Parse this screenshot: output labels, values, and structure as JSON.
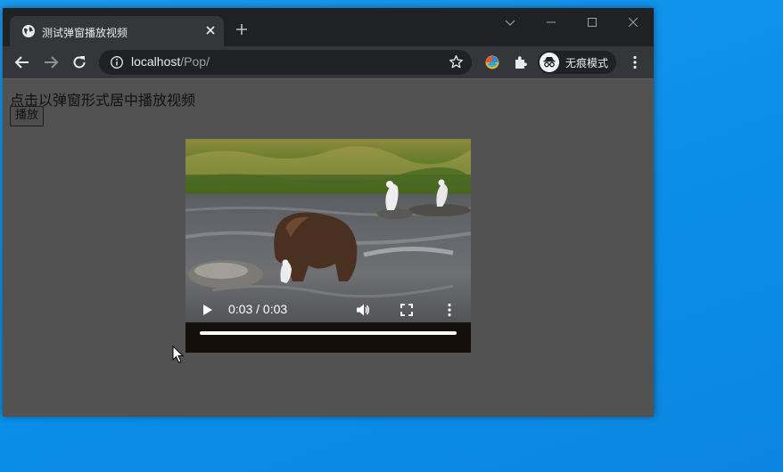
{
  "browser": {
    "tab_title": "测试弹窗播放视频",
    "url_host": "localhost",
    "url_path": "/Pop/",
    "incognito_label": "无痕模式"
  },
  "page": {
    "instruction": "点击以弹窗形式居中播放视频",
    "play_button": "播放"
  },
  "video": {
    "time_display": "0:03 / 0:03",
    "progress": 1.0
  },
  "colors": {
    "desktop": "#0a8ee8",
    "titlebar": "#202124",
    "toolbar": "#35363a",
    "page_bg": "#525252"
  }
}
